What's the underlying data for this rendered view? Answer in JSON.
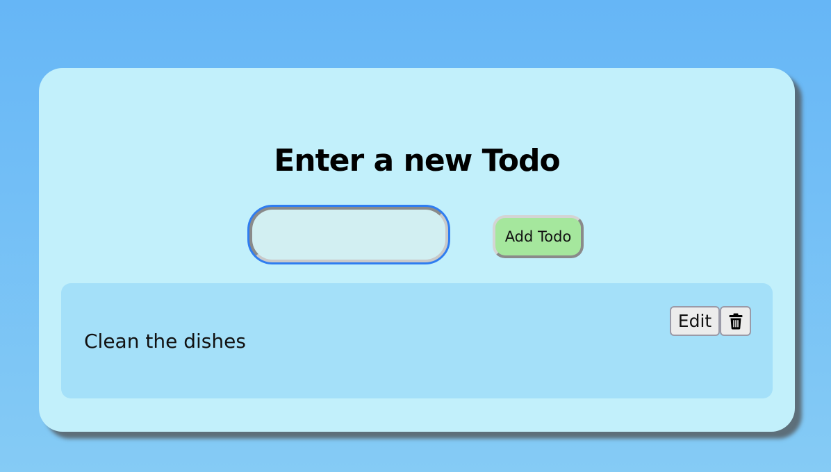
{
  "form": {
    "title": "Enter a new Todo",
    "input_value": "",
    "input_placeholder": "",
    "add_label": "Add Todo"
  },
  "todos": [
    {
      "text": "Clean the dishes",
      "edit_label": "Edit",
      "delete_icon": "trash-icon"
    }
  ],
  "colors": {
    "page_background": "#66b6f6",
    "card_background": "#c2f0fb",
    "list_background": "#a4e0f9",
    "input_background": "#d2eff2",
    "input_focus_ring": "#2f7df0",
    "add_button_background": "#a5e79d"
  }
}
